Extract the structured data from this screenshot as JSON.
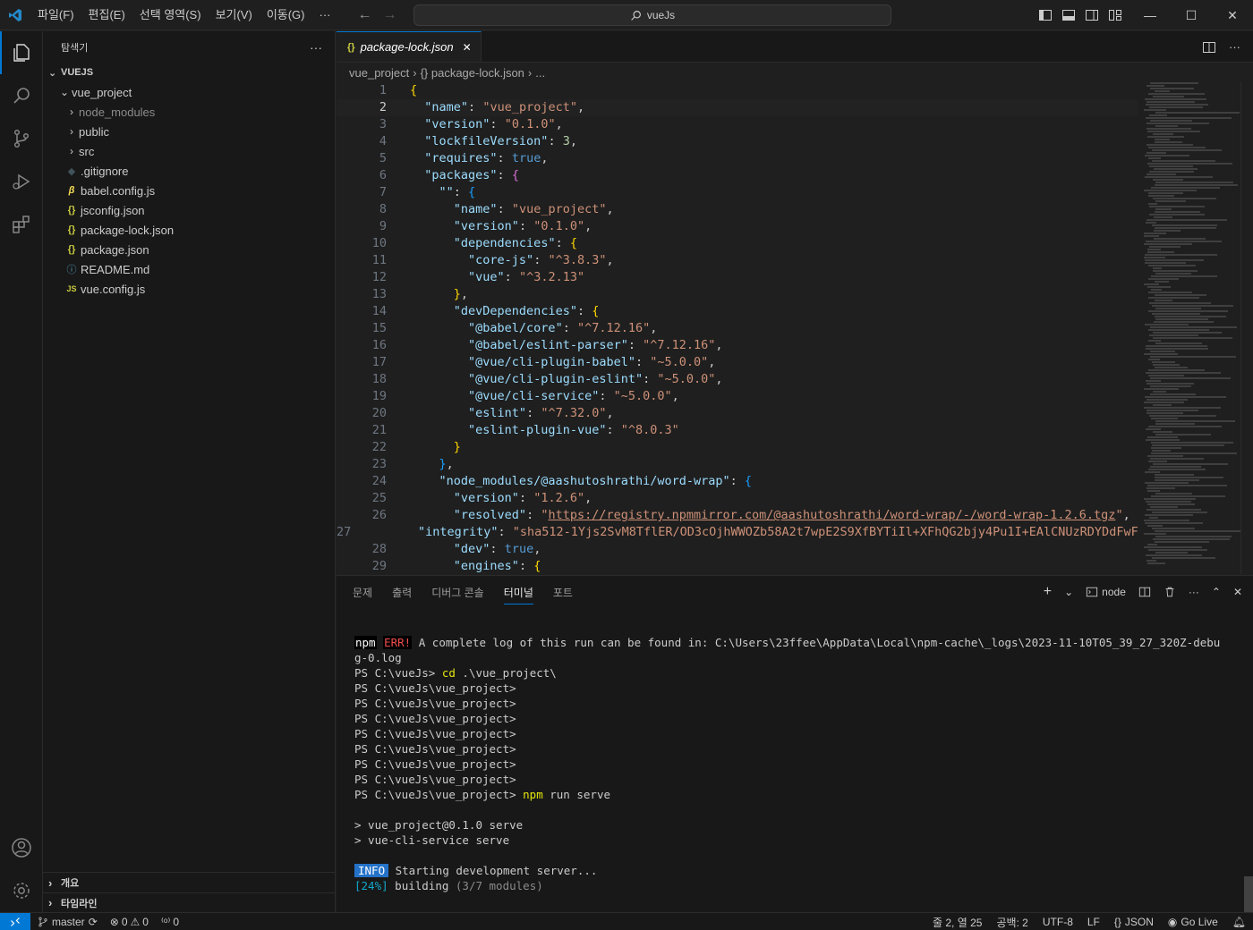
{
  "titlebar": {
    "menu": [
      "파일(F)",
      "편집(E)",
      "선택 영역(S)",
      "보기(V)",
      "이동(G)",
      "···"
    ],
    "search": "vueJs"
  },
  "sidebar": {
    "title": "탐색기",
    "more": "···",
    "root": "VUEJS",
    "folder": "vue_project",
    "items": [
      {
        "label": "node_modules",
        "type": "folder",
        "icon": ">"
      },
      {
        "label": "public",
        "type": "folder",
        "icon": ">"
      },
      {
        "label": "src",
        "type": "folder",
        "icon": ">"
      },
      {
        "label": ".gitignore",
        "type": "file",
        "icon": "◆"
      },
      {
        "label": "babel.config.js",
        "type": "file",
        "icon": "β"
      },
      {
        "label": "jsconfig.json",
        "type": "file",
        "icon": "{}"
      },
      {
        "label": "package-lock.json",
        "type": "file",
        "icon": "{}"
      },
      {
        "label": "package.json",
        "type": "file",
        "icon": "{}"
      },
      {
        "label": "README.md",
        "type": "file",
        "icon": "ⓘ"
      },
      {
        "label": "vue.config.js",
        "type": "file",
        "icon": "JS"
      }
    ],
    "outline": "개요",
    "timeline": "타임라인"
  },
  "editor": {
    "tab_label": "package-lock.json",
    "tab_icon": "{}",
    "close": "✕",
    "breadcrumb": [
      "vue_project",
      "{} package-lock.json",
      "..."
    ],
    "line_numbers": [
      "1",
      "2",
      "3",
      "4",
      "5",
      "6",
      "7",
      "8",
      "9",
      "10",
      "11",
      "12",
      "13",
      "14",
      "15",
      "16",
      "17",
      "18",
      "19",
      "20",
      "21",
      "22",
      "23",
      "24",
      "25",
      "26",
      "27",
      "28",
      "29"
    ]
  },
  "panel": {
    "tabs": [
      "문제",
      "출력",
      "디버그 콘솔",
      "터미널",
      "포트"
    ],
    "active_tab": "터미널",
    "shell": "node",
    "terminal": {
      "npm": "npm",
      "err": "ERR!",
      "err_msg": " A complete log of this run can be found in: C:\\Users\\23ffee\\AppData\\Local\\npm-cache\\_logs\\2023-11-10T05_39_27_320Z-debu",
      "err_cont": "g-0.log",
      "cd_prompt": "PS C:\\vueJs> ",
      "cd_cmd": "cd",
      "cd_arg": " .\\vue_project\\",
      "prompt": "PS C:\\vueJs\\vue_project>",
      "npm_cmd": "npm",
      "npm_args": " run serve",
      "serve1": "> vue_project@0.1.0 serve",
      "serve2": "> vue-cli-service serve",
      "info": "INFO",
      "info_msg": " Starting development server...",
      "pct": "[24%]",
      "building": " building ",
      "modules": "(3/7 modules)"
    }
  },
  "status": {
    "branch": "master",
    "errors": "0",
    "warnings": "0",
    "ports": "0",
    "position": "줄 2, 열 25",
    "spaces": "공백: 2",
    "encoding": "UTF-8",
    "eol": "LF",
    "language": "JSON",
    "golive": "Go Live"
  },
  "colors": {
    "accent": "#0078d4",
    "bg": "#1f1f1f",
    "sidebar_bg": "#181818"
  }
}
